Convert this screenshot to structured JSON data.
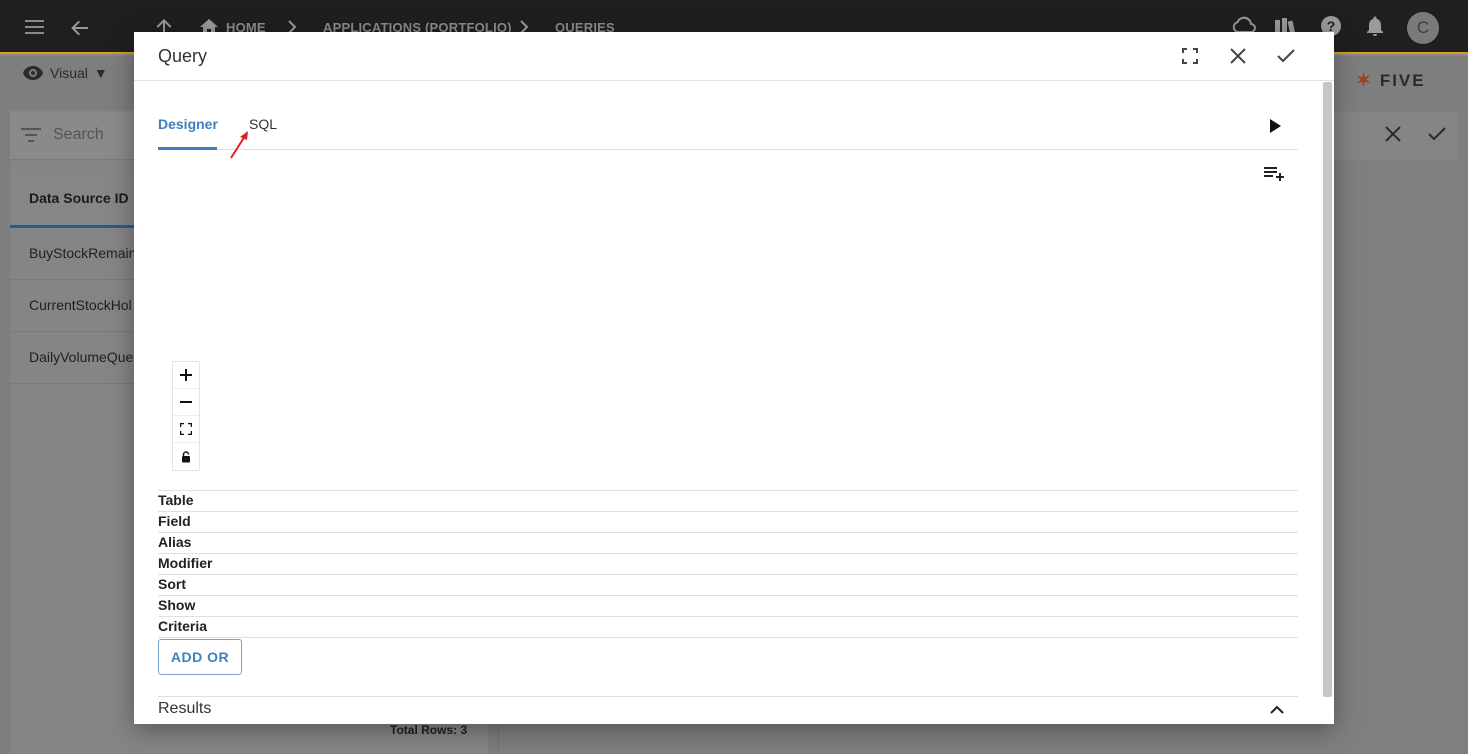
{
  "topbar": {
    "breadcrumbs": [
      "HOME",
      "APPLICATIONS (PORTFOLIO)",
      "QUERIES"
    ],
    "avatar_letter": "C"
  },
  "viewbar": {
    "label": "Visual"
  },
  "logo": {
    "text": "FIVE"
  },
  "list": {
    "search_placeholder": "Search",
    "column_header": "Data Source ID",
    "rows": [
      "BuyStockRemain",
      "CurrentStockHol",
      "DailyVolumeQue"
    ],
    "total_rows": "Total Rows: 3"
  },
  "modal": {
    "title": "Query",
    "tabs": {
      "designer": "Designer",
      "sql": "SQL"
    },
    "grid_rows": [
      "Table",
      "Field",
      "Alias",
      "Modifier",
      "Sort",
      "Show",
      "Criteria"
    ],
    "add_or_label": "ADD OR",
    "results_label": "Results"
  },
  "colors": {
    "accent": "#3f7fc1",
    "topbar_bg": "#1f1f1f",
    "topbar_border": "#d79f1a",
    "annotation_arrow": "#e02020"
  }
}
